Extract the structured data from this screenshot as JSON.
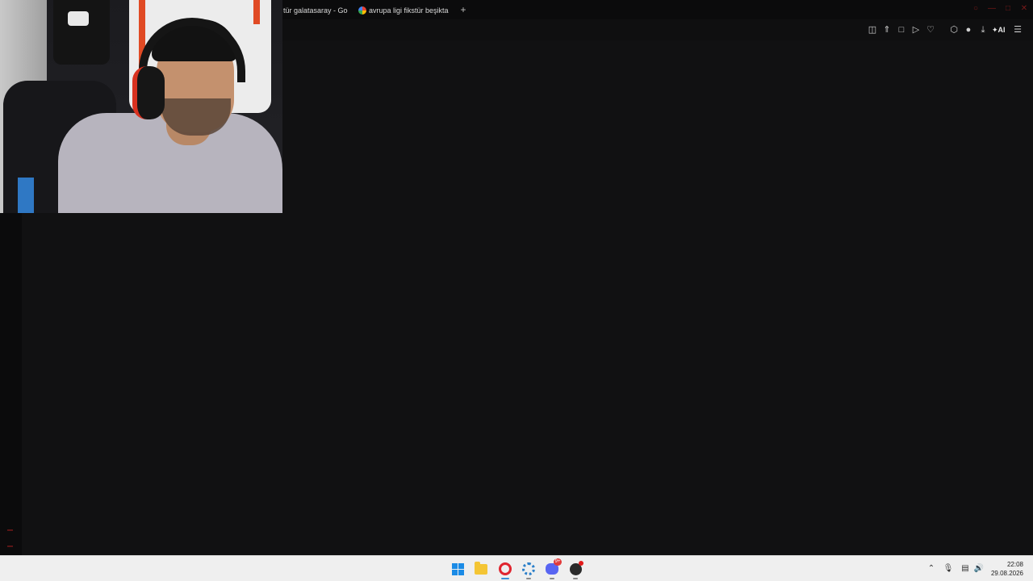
{
  "browser": {
    "tabs": [
      {
        "title": "tür galatasaray - Goo",
        "has_favicon": false
      },
      {
        "title": "avrupa ligi fikstür beşiktaş",
        "has_favicon": true
      }
    ],
    "new_tab_icon": "plus-icon",
    "toolbar_icons": [
      "sidebar-toggle-icon",
      "pin-icon",
      "snapshot-icon",
      "play-icon",
      "heart-icon",
      "extensions-icon",
      "profile-icon",
      "download-icon",
      "ai-sparkle-icon",
      "menu-icon"
    ],
    "ai_label": "AI"
  },
  "taskbar": {
    "apps": [
      "windows-start-icon",
      "file-explorer-icon",
      "opera-browser-icon",
      "settings-icon",
      "discord-icon",
      "obs-icon"
    ],
    "discord_badge": "9+",
    "tray_icons": [
      "chevron-up-icon",
      "microphone-icon",
      "display-icon",
      "volume-icon"
    ],
    "time": "22:08",
    "date": "29.08.2026"
  },
  "colors": {
    "background": "#111112",
    "taskbar": "#efefef",
    "accent_active": "#3a8fd8"
  }
}
